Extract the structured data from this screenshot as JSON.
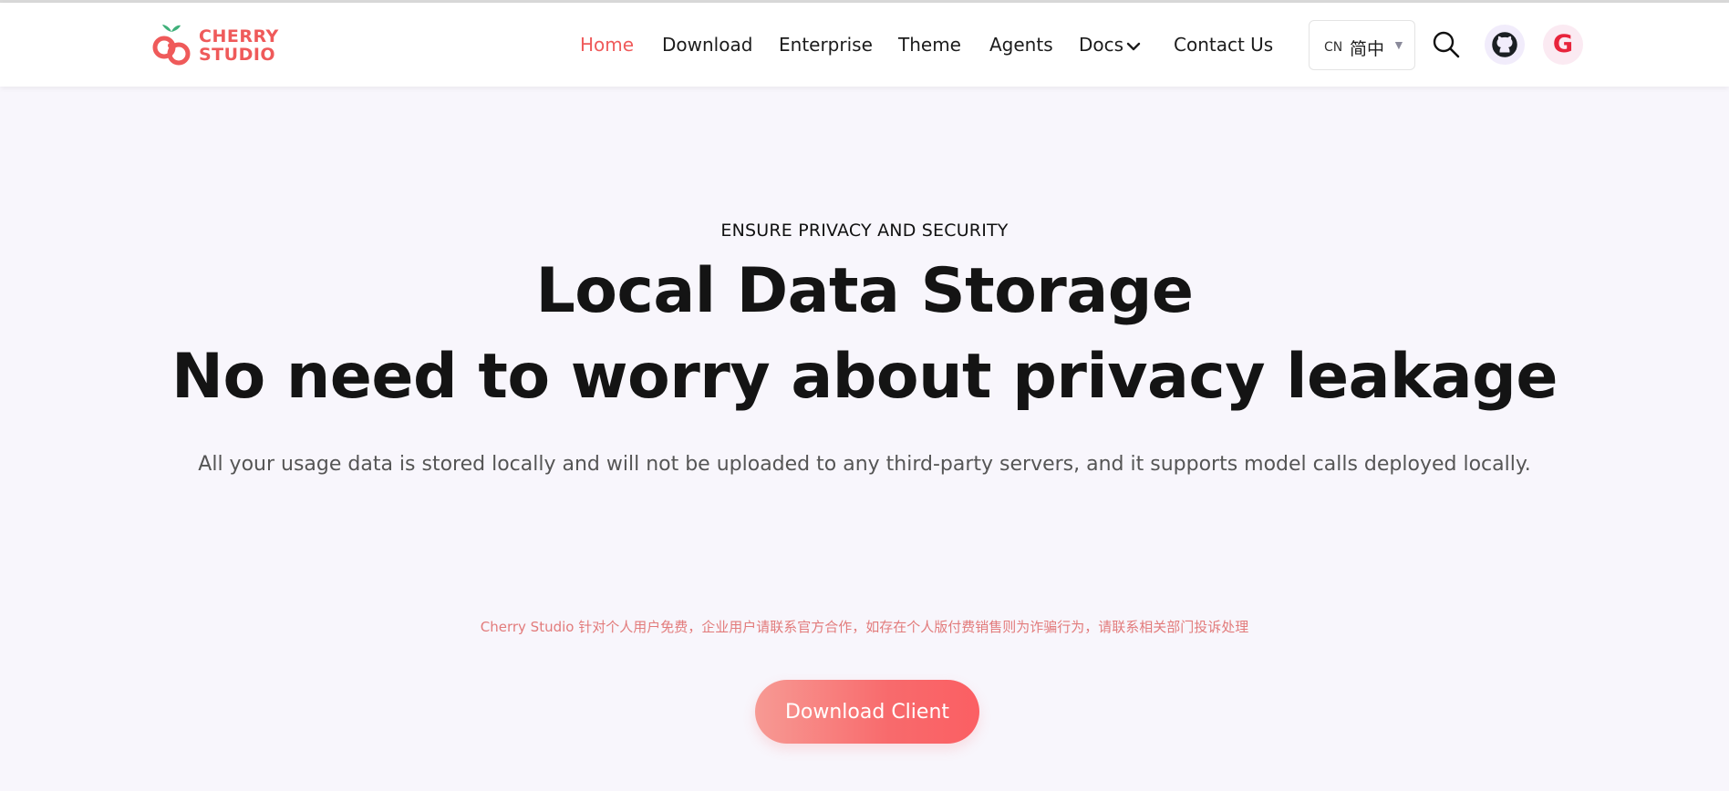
{
  "brand": {
    "logo_line1": "CHERRY",
    "logo_line2": "STUDIO",
    "accent": "#ef5a5a",
    "leaf_color": "#3fb07a"
  },
  "nav": {
    "items": [
      {
        "label": "Home",
        "active": true
      },
      {
        "label": "Download",
        "active": false
      },
      {
        "label": "Enterprise",
        "active": false
      },
      {
        "label": "Theme",
        "active": false
      },
      {
        "label": "Agents",
        "active": false
      },
      {
        "label": "Docs",
        "active": false,
        "icon": "chevron-down-icon"
      },
      {
        "label": "Contact Us",
        "active": false
      }
    ],
    "language": {
      "code": "CN",
      "name": "简中",
      "icon": "caret-down-icon"
    },
    "icons": [
      "search-icon",
      "github-icon",
      "google-icon"
    ]
  },
  "hero": {
    "eyebrow": "ENSURE PRIVACY AND SECURITY",
    "headline_line1": "Local Data Storage",
    "headline_line2": "No need to worry about privacy leakage",
    "subtext": "All your usage data is stored locally and will not be uploaded to any third-party servers, and it supports model calls deployed locally.",
    "notice": "Cherry Studio 针对个人用户免费，企业用户请联系官方合作，如存在个人版付费销售则为诈骗行为，请联系相关部门投诉处理",
    "cta_label": "Download Client"
  }
}
